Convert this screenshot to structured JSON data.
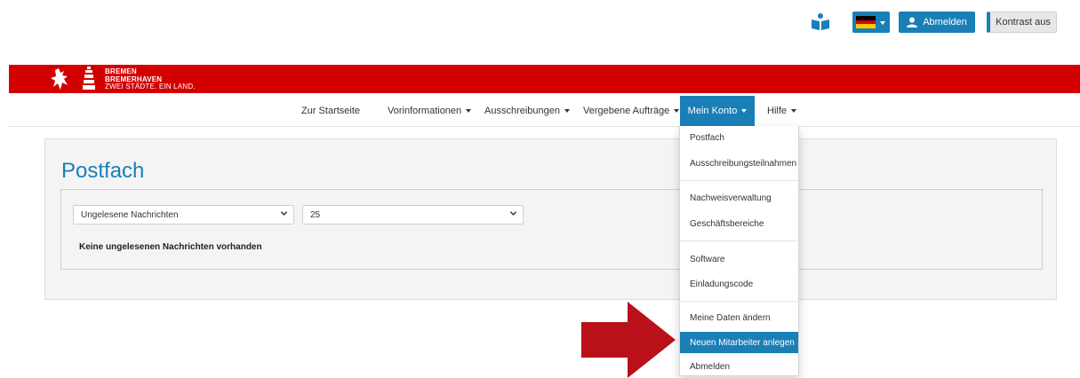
{
  "topbar": {
    "book_icon": "open-book-person-icon",
    "language_flag": "germany-flag",
    "logout_label": "Abmelden",
    "contrast_label": "Kontrast aus"
  },
  "header": {
    "brand_line1": "BREMEN",
    "brand_line2": "BREMERHAVEN",
    "brand_line3": "ZWEI STÄDTE. EIN LAND.",
    "accent": "#d40000"
  },
  "nav": {
    "home": "Zur Startseite",
    "preinfo": "Vorinformationen",
    "tenders": "Ausschreibungen",
    "awarded": "Vergebene Aufträge",
    "account": "Mein Konto",
    "help": "Hilfe"
  },
  "page": {
    "title": "Postfach",
    "filter_select": "Ungelesene Nachrichten",
    "page_size_select": "25",
    "empty_message": "Keine ungelesenen Nachrichten vorhanden"
  },
  "account_menu": {
    "groups": [
      [
        "Postfach",
        "Ausschreibungsteilnahmen"
      ],
      [
        "Nachweisverwaltung",
        "Geschäftsbereiche"
      ],
      [
        "Software",
        "Einladungscode"
      ],
      [
        "Meine Daten ändern",
        "Neuen Mitarbeiter anlegen",
        "Abmelden"
      ]
    ],
    "highlighted": "Neuen Mitarbeiter anlegen"
  },
  "colors": {
    "primary": "#1a7fb7",
    "brand_red": "#d40000",
    "annotation_arrow": "#b9101a"
  }
}
